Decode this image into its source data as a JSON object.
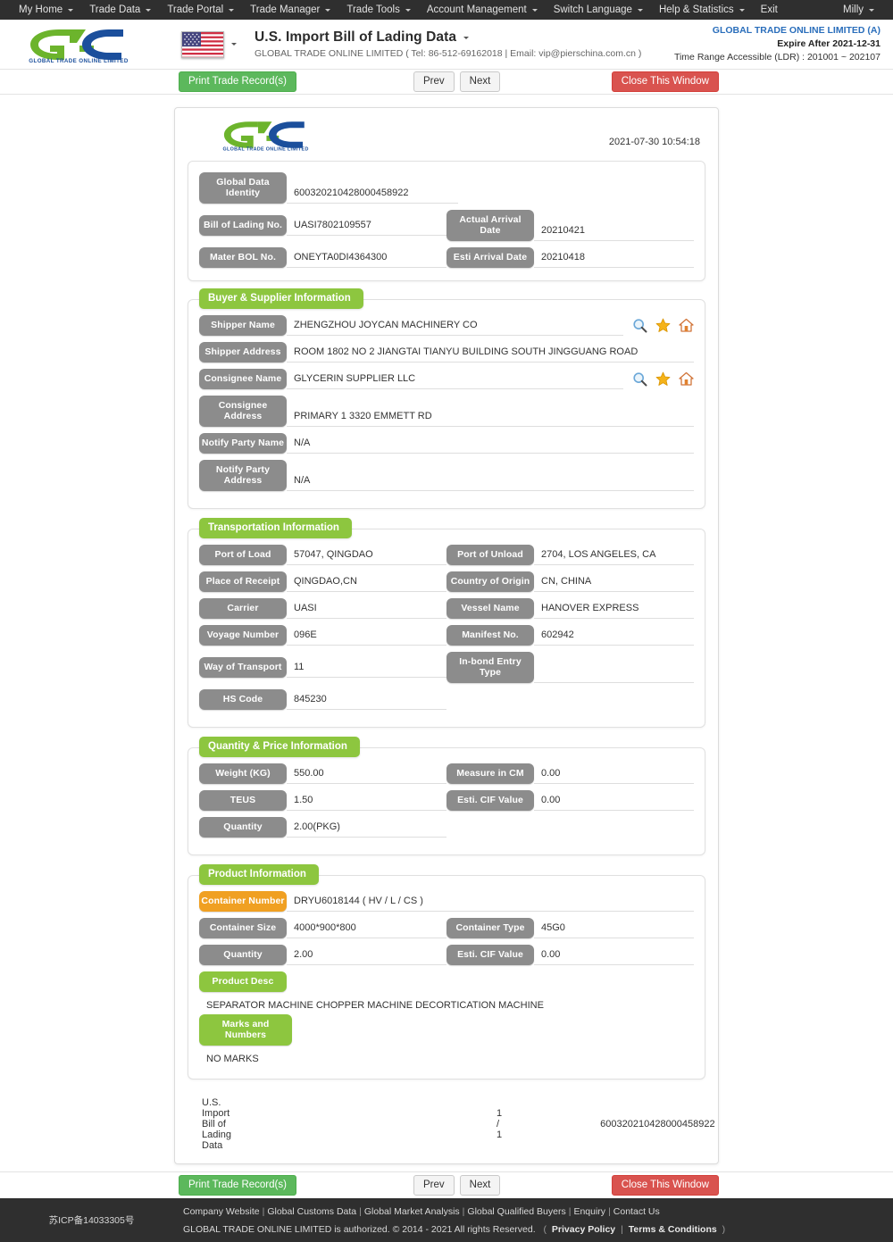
{
  "topnav": {
    "items": [
      {
        "label": "My Home",
        "caret": true
      },
      {
        "label": "Trade Data",
        "caret": true
      },
      {
        "label": "Trade Portal",
        "caret": true
      },
      {
        "label": "Trade Manager",
        "caret": true
      },
      {
        "label": "Trade Tools",
        "caret": true
      },
      {
        "label": "Account Management",
        "caret": true
      },
      {
        "label": "Switch Language",
        "caret": true
      },
      {
        "label": "Help & Statistics",
        "caret": true
      },
      {
        "label": "Exit",
        "caret": false
      }
    ],
    "user": "Milly"
  },
  "header": {
    "logo_text": "GLOBAL TRADE ONLINE LIMITED",
    "flag": "us-flag-icon",
    "title": "U.S. Import Bill of Lading Data",
    "subtitle": "GLOBAL TRADE ONLINE LIMITED ( Tel: 86-512-69162018 | Email: vip@pierschina.com.cn )",
    "account": "GLOBAL TRADE ONLINE LIMITED (A)",
    "expire": "Expire After 2021-12-31",
    "time_range": "Time Range Accessible (LDR) : 201001 ~ 202107"
  },
  "actionbar": {
    "print_label": "Print Trade Record(s)",
    "prev_label": "Prev",
    "next_label": "Next",
    "close_label": "Close This Window"
  },
  "sheet": {
    "timestamp": "2021-07-30 10:54:18",
    "identity": {
      "global_data_identity_label": "Global Data Identity",
      "global_data_identity_value": "600320210428000458922",
      "bol_label": "Bill of Lading No.",
      "bol_value": "UASI7802109557",
      "actual_arrival_label": "Actual Arrival Date",
      "actual_arrival_value": "20210421",
      "master_bol_label": "Mater BOL No.",
      "master_bol_value": "ONEYTA0DI4364300",
      "esti_arrival_label": "Esti Arrival Date",
      "esti_arrival_value": "20210418"
    },
    "buyer_supplier": {
      "title": "Buyer & Supplier Information",
      "rows": [
        {
          "label": "Shipper Name",
          "value": "ZHENGZHOU JOYCAN MACHINERY CO",
          "icons": true
        },
        {
          "label": "Shipper Address",
          "value": "ROOM 1802 NO 2 JIANGTAI TIANYU BUILDING SOUTH JINGGUANG ROAD",
          "icons": false
        },
        {
          "label": "Consignee Name",
          "value": "GLYCERIN SUPPLIER LLC",
          "icons": true
        },
        {
          "label": "Consignee Address",
          "value": "PRIMARY 1 3320 EMMETT RD",
          "icons": false
        },
        {
          "label": "Notify Party Name",
          "value": "N/A",
          "icons": false
        },
        {
          "label": "Notify Party Address",
          "value": "N/A",
          "icons": false
        }
      ]
    },
    "transportation": {
      "title": "Transportation Information",
      "rows": [
        {
          "l_label": "Port of Load",
          "l_value": "57047, QINGDAO",
          "r_label": "Port of Unload",
          "r_value": "2704, LOS ANGELES, CA"
        },
        {
          "l_label": "Place of Receipt",
          "l_value": "QINGDAO,CN",
          "r_label": "Country of Origin",
          "r_value": "CN, CHINA"
        },
        {
          "l_label": "Carrier",
          "l_value": "UASI",
          "r_label": "Vessel Name",
          "r_value": "HANOVER EXPRESS"
        },
        {
          "l_label": "Voyage Number",
          "l_value": "096E",
          "r_label": "Manifest No.",
          "r_value": "602942"
        },
        {
          "l_label": "Way of Transport",
          "l_value": "11",
          "r_label": "In-bond Entry Type",
          "r_value": ""
        },
        {
          "l_label": "HS Code",
          "l_value": "845230",
          "r_label": "",
          "r_value": ""
        }
      ]
    },
    "quantity_price": {
      "title": "Quantity & Price Information",
      "rows": [
        {
          "l_label": "Weight (KG)",
          "l_value": "550.00",
          "r_label": "Measure in CM",
          "r_value": "0.00"
        },
        {
          "l_label": "TEUS",
          "l_value": "1.50",
          "r_label": "Esti. CIF Value",
          "r_value": "0.00"
        },
        {
          "l_label": "Quantity",
          "l_value": "2.00(PKG)",
          "r_label": "",
          "r_value": ""
        }
      ]
    },
    "product": {
      "title": "Product Information",
      "container_number_label": "Container Number",
      "container_number_value": "DRYU6018144 ( HV / L / CS )",
      "rows": [
        {
          "l_label": "Container Size",
          "l_value": "4000*900*800",
          "r_label": "Container Type",
          "r_value": "45G0"
        },
        {
          "l_label": "Quantity",
          "l_value": "2.00",
          "r_label": "Esti. CIF Value",
          "r_value": "0.00"
        }
      ],
      "product_desc_label": "Product Desc",
      "product_desc_value": "SEPARATOR MACHINE CHOPPER MACHINE DECORTICATION MACHINE",
      "marks_label": "Marks and Numbers",
      "marks_value": "NO MARKS"
    },
    "footer": {
      "doc_name": "U.S. Import Bill of Lading Data",
      "page": "1 / 1",
      "identity": "600320210428000458922"
    }
  },
  "footer": {
    "icp": "苏ICP备14033305号",
    "links": [
      "Company Website",
      "Global Customs Data",
      "Global Market Analysis",
      "Global Qualified Buyers",
      "Enquiry",
      "Contact Us"
    ],
    "copyright": "GLOBAL TRADE ONLINE LIMITED is authorized. © 2014 - 2021 All rights Reserved.",
    "privacy": "Privacy Policy",
    "terms": "Terms & Conditions"
  },
  "colors": {
    "nav_bg": "#2f2f2f",
    "green": "#8dc63f",
    "orange": "#f0a022",
    "gray_pill": "#8c8c8c",
    "btn_green": "#5cb85c",
    "btn_red": "#d9534f",
    "link_blue": "#2a6ebb"
  }
}
